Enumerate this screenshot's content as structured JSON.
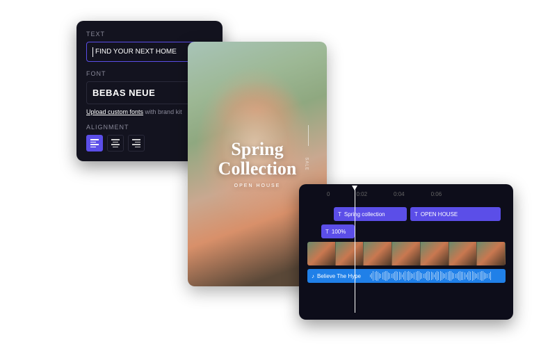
{
  "textPanel": {
    "textLabel": "TEXT",
    "textValue": "FIND YOUR NEXT HOME",
    "fontLabel": "FONT",
    "fontName": "BEBAS NEUE",
    "uploadLinkUnderlined": "Upload custom fonts",
    "uploadLinkRest": " with brand kit",
    "alignLabel": "ALIGNMENT"
  },
  "preview": {
    "titleLine1": "Spring",
    "titleLine2": "Collection",
    "subtitle": "OPEN HOUSE",
    "sideText": "SALE"
  },
  "timeline": {
    "ruler": [
      "0",
      "0:02",
      "0:04",
      "0:06"
    ],
    "textClip1": "Spring collection",
    "textClip2": "OPEN HOUSE",
    "scaleClip": "100%",
    "audioClip": "Believe The Hype"
  }
}
